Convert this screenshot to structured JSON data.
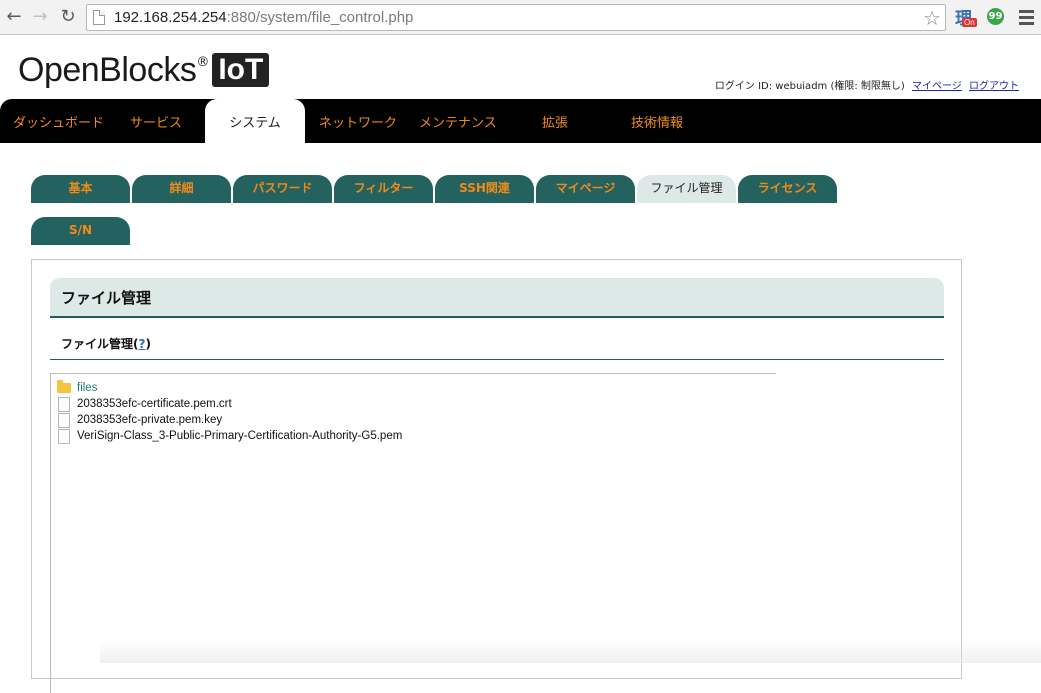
{
  "browser": {
    "url_host": "192.168.254.254",
    "url_rest": ":880/system/file_control.php",
    "back_label": "←",
    "forward_label": "→",
    "reload_label": "↻",
    "ext_ri_kanji": "理",
    "ext_ri_badge": "On",
    "ext_green_glyph": "99"
  },
  "header": {
    "logo_text": "OpenBlocks",
    "logo_reg": "®",
    "logo_badge": "IoT",
    "login_text": "ログイン ID: webuiadm (権限: 制限無し)",
    "mypage_link": "マイページ",
    "logout_link": "ログアウト"
  },
  "mainnav": {
    "items": [
      {
        "label": "ダッシュボード"
      },
      {
        "label": "サービス"
      },
      {
        "label": "システム",
        "active": true
      },
      {
        "label": "ネットワーク"
      },
      {
        "label": "メンテナンス"
      },
      {
        "label": "拡張"
      },
      {
        "label": "技術情報"
      }
    ]
  },
  "subtabs": {
    "items": [
      {
        "label": "基本"
      },
      {
        "label": "詳細"
      },
      {
        "label": "パスワード"
      },
      {
        "label": "フィルター"
      },
      {
        "label": "SSH関連"
      },
      {
        "label": "マイページ"
      },
      {
        "label": "ファイル管理",
        "active": true
      },
      {
        "label": "ライセンス"
      },
      {
        "label": "S/N"
      }
    ]
  },
  "main": {
    "section_title": "ファイル管理",
    "sub_title": "ファイル管理",
    "help_open": "(",
    "help_link": "?",
    "help_close": ")",
    "tree": [
      {
        "type": "folder",
        "name": "files"
      },
      {
        "type": "file",
        "name": "2038353efc-certificate.pem.crt"
      },
      {
        "type": "file",
        "name": "2038353efc-private.pem.key"
      },
      {
        "type": "file",
        "name": "VeriSign-Class_3-Public-Primary-Certification-Authority-G5.pem"
      }
    ]
  },
  "colors": {
    "nav_bg": "#000000",
    "nav_text": "#f08a1a",
    "tab_bg": "#23625e",
    "tab_active_bg": "#dde9e7",
    "section_bg": "#dde9e7"
  }
}
